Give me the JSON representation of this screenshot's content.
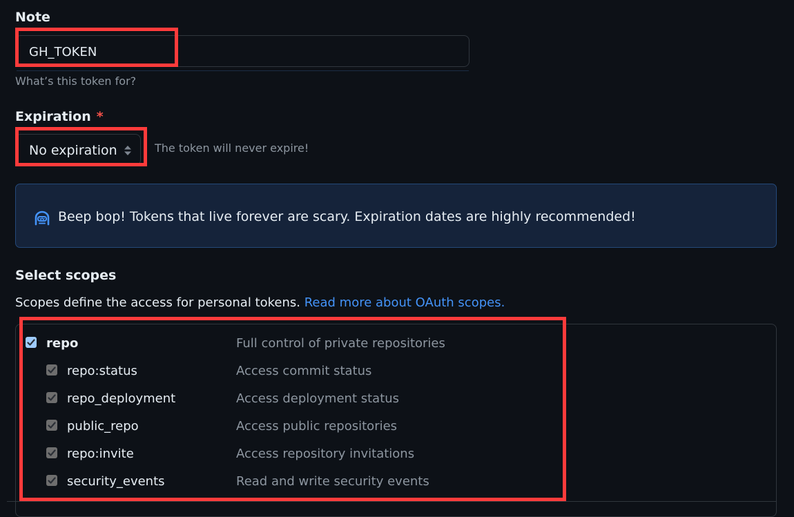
{
  "note": {
    "label": "Note",
    "value": "GH_TOKEN",
    "hint": "What’s this token for?"
  },
  "expiration": {
    "label": "Expiration",
    "required_mark": "*",
    "selected": "No expiration",
    "hint": "The token will never expire!"
  },
  "banner": {
    "icon": "copilot-robot-icon",
    "text": "Beep bop! Tokens that live forever are scary. Expiration dates are highly recommended!"
  },
  "scopes": {
    "title": "Select scopes",
    "description": "Scopes define the access for personal tokens.",
    "link_text": "Read more about OAuth scopes.",
    "items": [
      {
        "name": "repo",
        "description": "Full control of private repositories",
        "checked": true,
        "level": "primary"
      },
      {
        "name": "repo:status",
        "description": "Access commit status",
        "checked": true,
        "level": "sub"
      },
      {
        "name": "repo_deployment",
        "description": "Access deployment status",
        "checked": true,
        "level": "sub"
      },
      {
        "name": "public_repo",
        "description": "Access public repositories",
        "checked": true,
        "level": "sub"
      },
      {
        "name": "repo:invite",
        "description": "Access repository invitations",
        "checked": true,
        "level": "sub"
      },
      {
        "name": "security_events",
        "description": "Read and write security events",
        "checked": true,
        "level": "sub"
      }
    ]
  },
  "colors": {
    "background": "#0d1117",
    "accent_link": "#4493f8",
    "annotation_red": "#ff3b3b",
    "required_red": "#f85149",
    "banner_bg": "#15233a"
  }
}
